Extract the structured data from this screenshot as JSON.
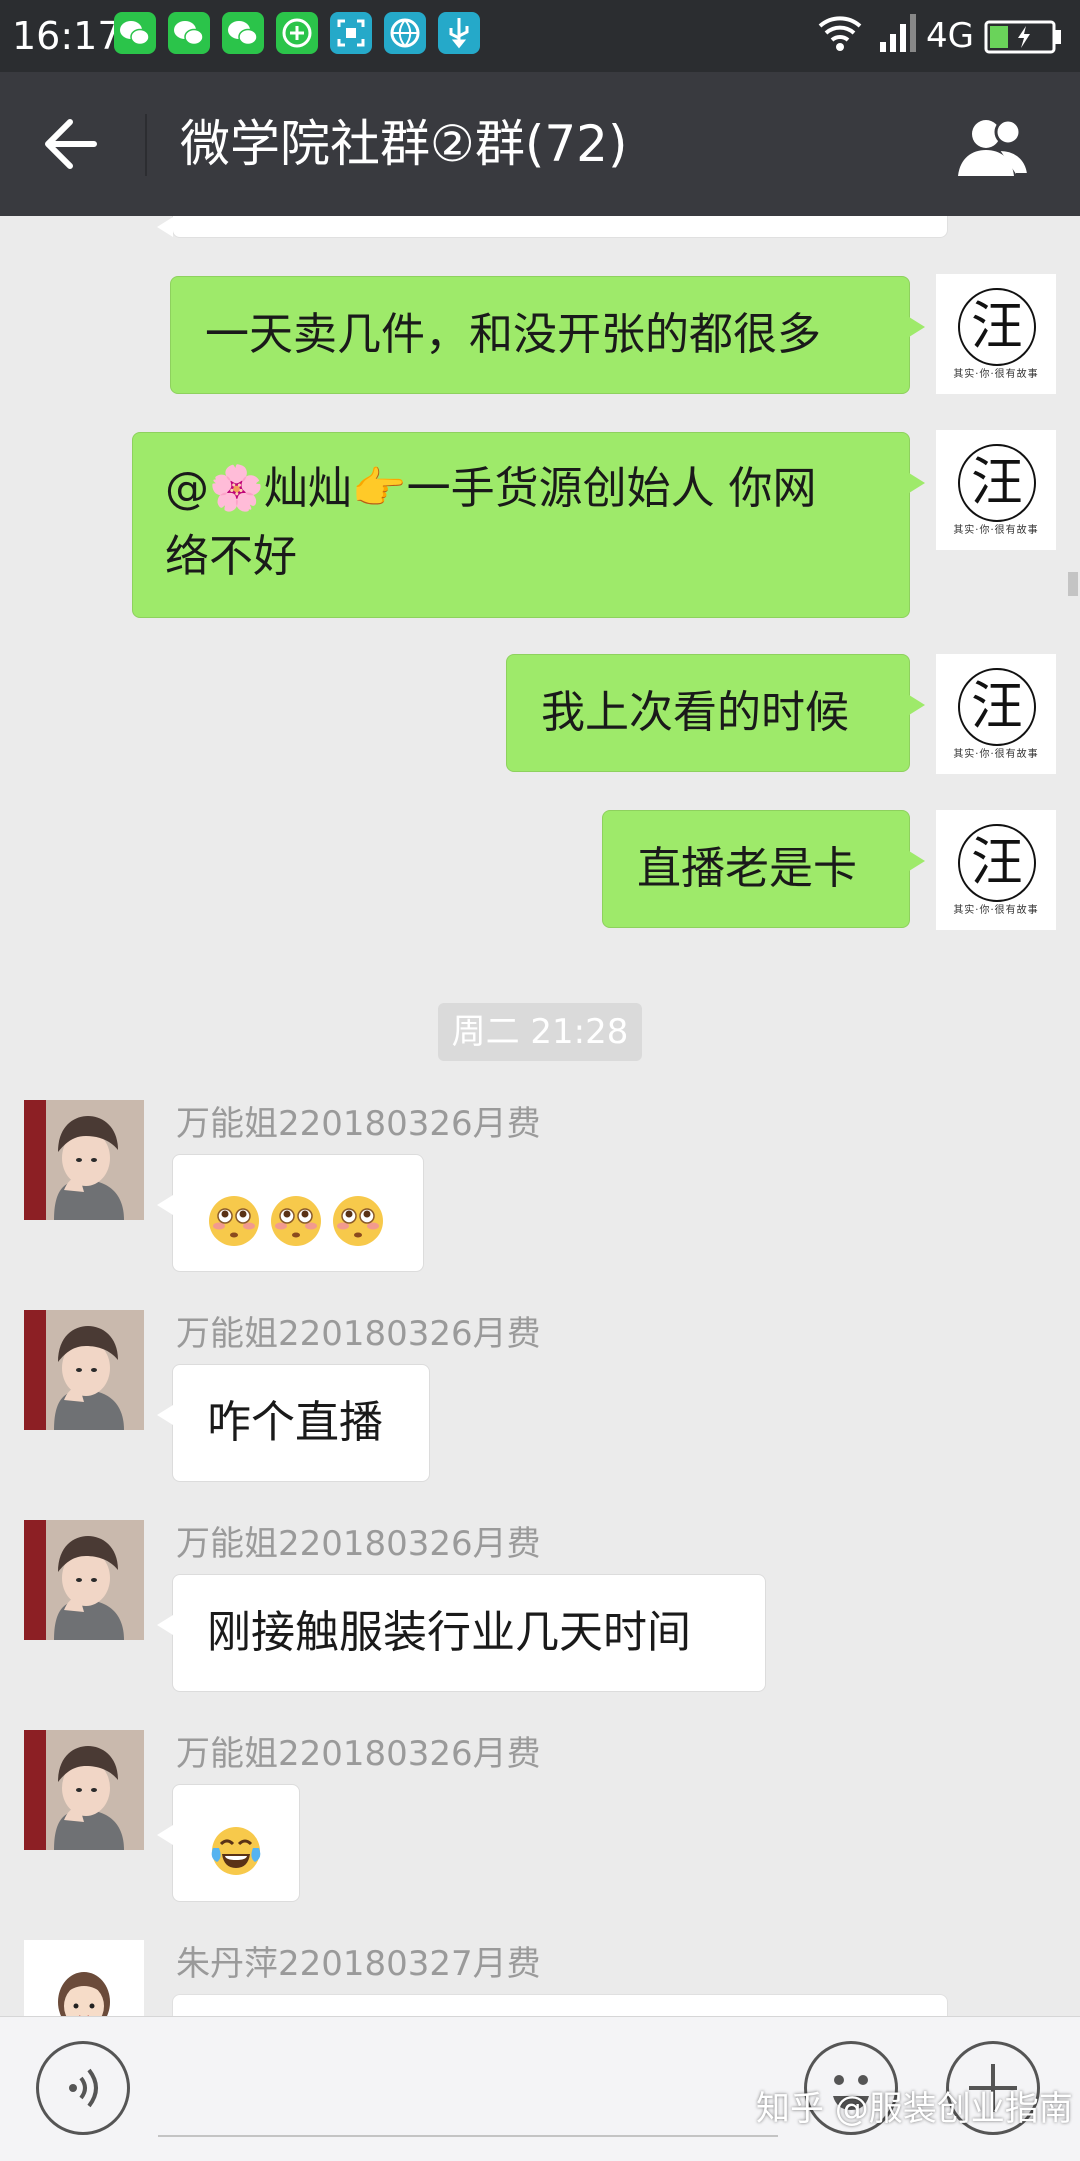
{
  "status_bar": {
    "time": "16:17",
    "network": "4G",
    "app_icons": [
      "wechat-icon",
      "wechat-icon",
      "wechat-icon",
      "app-plus-icon",
      "scan-icon",
      "ball-icon",
      "usb-icon"
    ],
    "battery_level": 0.3
  },
  "header": {
    "title": "微学院社群②群(72)",
    "back_icon": "arrow-left-icon",
    "members_icon": "group-icon"
  },
  "messages": {
    "m1": {
      "direction": "outgoing",
      "text": "一天卖几件，和没开张的都很多"
    },
    "m2": {
      "direction": "outgoing",
      "line1": "@🌸灿灿👉一手货源创始人  你网",
      "line2": "络不好"
    },
    "m3": {
      "direction": "outgoing",
      "text": "我上次看的时候"
    },
    "m4": {
      "direction": "outgoing",
      "text": "直播老是卡"
    },
    "timestamp": "周二 21:28",
    "m5": {
      "direction": "incoming",
      "sender": "万能姐220180326月费",
      "content": "flushed-face-emoji x3"
    },
    "m6": {
      "direction": "incoming",
      "sender": "万能姐220180326月费",
      "text": "咋个直播"
    },
    "m7": {
      "direction": "incoming",
      "sender": "万能姐220180326月费",
      "text": "刚接触服装行业几天时间"
    },
    "m8": {
      "direction": "incoming",
      "sender": "万能姐220180326月费",
      "content": "tears-of-joy-emoji"
    },
    "m9": {
      "direction": "incoming",
      "sender": "朱丹萍220180327月费"
    }
  },
  "avatars": {
    "self_glyph": "汪",
    "self_tagline": "其实·你·很有故事"
  },
  "input_bar": {
    "watermark": "知乎 @服装创业指南"
  },
  "colors": {
    "header_bg": "#393a3f",
    "outgoing_bubble": "#9eea6a",
    "incoming_bubble": "#ffffff",
    "chat_bg": "#ebebeb"
  }
}
